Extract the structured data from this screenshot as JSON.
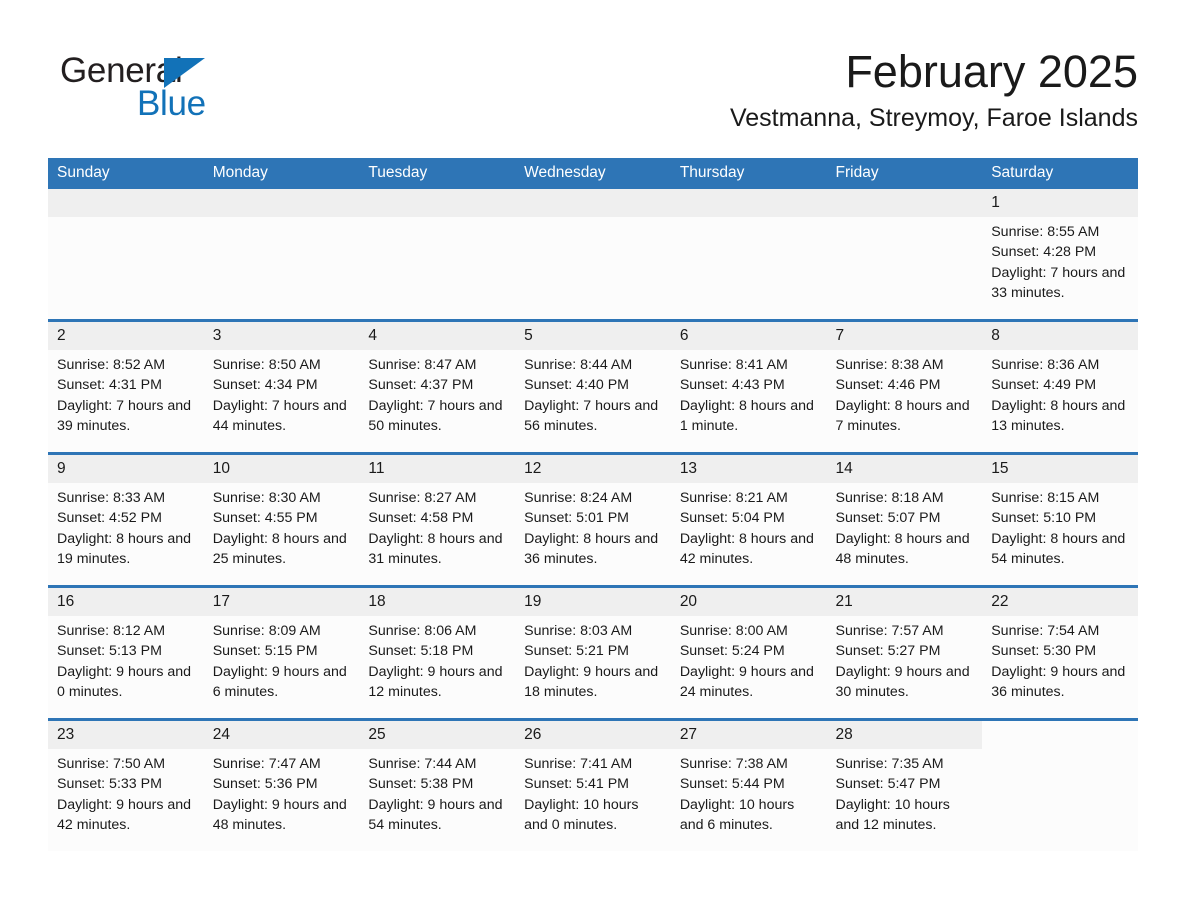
{
  "brand": {
    "name_part1": "General",
    "name_part2": "Blue",
    "accent_color": "#1272b8",
    "triangle_icon": "triangle-right-icon"
  },
  "header": {
    "month_title": "February 2025",
    "location": "Vestmanna, Streymoy, Faroe Islands"
  },
  "theme": {
    "header_bar_color": "#2e75b6",
    "daynum_band_color": "#efefef",
    "cell_background": "#fcfcfc",
    "text_color": "#1a1a1a"
  },
  "weekday_headers": [
    "Sunday",
    "Monday",
    "Tuesday",
    "Wednesday",
    "Thursday",
    "Friday",
    "Saturday"
  ],
  "weeks": [
    [
      {
        "empty": true
      },
      {
        "empty": true
      },
      {
        "empty": true
      },
      {
        "empty": true
      },
      {
        "empty": true
      },
      {
        "empty": true
      },
      {
        "day": "1",
        "sunrise": "Sunrise: 8:55 AM",
        "sunset": "Sunset: 4:28 PM",
        "daylight": "Daylight: 7 hours and 33 minutes."
      }
    ],
    [
      {
        "day": "2",
        "sunrise": "Sunrise: 8:52 AM",
        "sunset": "Sunset: 4:31 PM",
        "daylight": "Daylight: 7 hours and 39 minutes."
      },
      {
        "day": "3",
        "sunrise": "Sunrise: 8:50 AM",
        "sunset": "Sunset: 4:34 PM",
        "daylight": "Daylight: 7 hours and 44 minutes."
      },
      {
        "day": "4",
        "sunrise": "Sunrise: 8:47 AM",
        "sunset": "Sunset: 4:37 PM",
        "daylight": "Daylight: 7 hours and 50 minutes."
      },
      {
        "day": "5",
        "sunrise": "Sunrise: 8:44 AM",
        "sunset": "Sunset: 4:40 PM",
        "daylight": "Daylight: 7 hours and 56 minutes."
      },
      {
        "day": "6",
        "sunrise": "Sunrise: 8:41 AM",
        "sunset": "Sunset: 4:43 PM",
        "daylight": "Daylight: 8 hours and 1 minute."
      },
      {
        "day": "7",
        "sunrise": "Sunrise: 8:38 AM",
        "sunset": "Sunset: 4:46 PM",
        "daylight": "Daylight: 8 hours and 7 minutes."
      },
      {
        "day": "8",
        "sunrise": "Sunrise: 8:36 AM",
        "sunset": "Sunset: 4:49 PM",
        "daylight": "Daylight: 8 hours and 13 minutes."
      }
    ],
    [
      {
        "day": "9",
        "sunrise": "Sunrise: 8:33 AM",
        "sunset": "Sunset: 4:52 PM",
        "daylight": "Daylight: 8 hours and 19 minutes."
      },
      {
        "day": "10",
        "sunrise": "Sunrise: 8:30 AM",
        "sunset": "Sunset: 4:55 PM",
        "daylight": "Daylight: 8 hours and 25 minutes."
      },
      {
        "day": "11",
        "sunrise": "Sunrise: 8:27 AM",
        "sunset": "Sunset: 4:58 PM",
        "daylight": "Daylight: 8 hours and 31 minutes."
      },
      {
        "day": "12",
        "sunrise": "Sunrise: 8:24 AM",
        "sunset": "Sunset: 5:01 PM",
        "daylight": "Daylight: 8 hours and 36 minutes."
      },
      {
        "day": "13",
        "sunrise": "Sunrise: 8:21 AM",
        "sunset": "Sunset: 5:04 PM",
        "daylight": "Daylight: 8 hours and 42 minutes."
      },
      {
        "day": "14",
        "sunrise": "Sunrise: 8:18 AM",
        "sunset": "Sunset: 5:07 PM",
        "daylight": "Daylight: 8 hours and 48 minutes."
      },
      {
        "day": "15",
        "sunrise": "Sunrise: 8:15 AM",
        "sunset": "Sunset: 5:10 PM",
        "daylight": "Daylight: 8 hours and 54 minutes."
      }
    ],
    [
      {
        "day": "16",
        "sunrise": "Sunrise: 8:12 AM",
        "sunset": "Sunset: 5:13 PM",
        "daylight": "Daylight: 9 hours and 0 minutes."
      },
      {
        "day": "17",
        "sunrise": "Sunrise: 8:09 AM",
        "sunset": "Sunset: 5:15 PM",
        "daylight": "Daylight: 9 hours and 6 minutes."
      },
      {
        "day": "18",
        "sunrise": "Sunrise: 8:06 AM",
        "sunset": "Sunset: 5:18 PM",
        "daylight": "Daylight: 9 hours and 12 minutes."
      },
      {
        "day": "19",
        "sunrise": "Sunrise: 8:03 AM",
        "sunset": "Sunset: 5:21 PM",
        "daylight": "Daylight: 9 hours and 18 minutes."
      },
      {
        "day": "20",
        "sunrise": "Sunrise: 8:00 AM",
        "sunset": "Sunset: 5:24 PM",
        "daylight": "Daylight: 9 hours and 24 minutes."
      },
      {
        "day": "21",
        "sunrise": "Sunrise: 7:57 AM",
        "sunset": "Sunset: 5:27 PM",
        "daylight": "Daylight: 9 hours and 30 minutes."
      },
      {
        "day": "22",
        "sunrise": "Sunrise: 7:54 AM",
        "sunset": "Sunset: 5:30 PM",
        "daylight": "Daylight: 9 hours and 36 minutes."
      }
    ],
    [
      {
        "day": "23",
        "sunrise": "Sunrise: 7:50 AM",
        "sunset": "Sunset: 5:33 PM",
        "daylight": "Daylight: 9 hours and 42 minutes."
      },
      {
        "day": "24",
        "sunrise": "Sunrise: 7:47 AM",
        "sunset": "Sunset: 5:36 PM",
        "daylight": "Daylight: 9 hours and 48 minutes."
      },
      {
        "day": "25",
        "sunrise": "Sunrise: 7:44 AM",
        "sunset": "Sunset: 5:38 PM",
        "daylight": "Daylight: 9 hours and 54 minutes."
      },
      {
        "day": "26",
        "sunrise": "Sunrise: 7:41 AM",
        "sunset": "Sunset: 5:41 PM",
        "daylight": "Daylight: 10 hours and 0 minutes."
      },
      {
        "day": "27",
        "sunrise": "Sunrise: 7:38 AM",
        "sunset": "Sunset: 5:44 PM",
        "daylight": "Daylight: 10 hours and 6 minutes."
      },
      {
        "day": "28",
        "sunrise": "Sunrise: 7:35 AM",
        "sunset": "Sunset: 5:47 PM",
        "daylight": "Daylight: 10 hours and 12 minutes."
      },
      {
        "blank": true
      }
    ]
  ]
}
